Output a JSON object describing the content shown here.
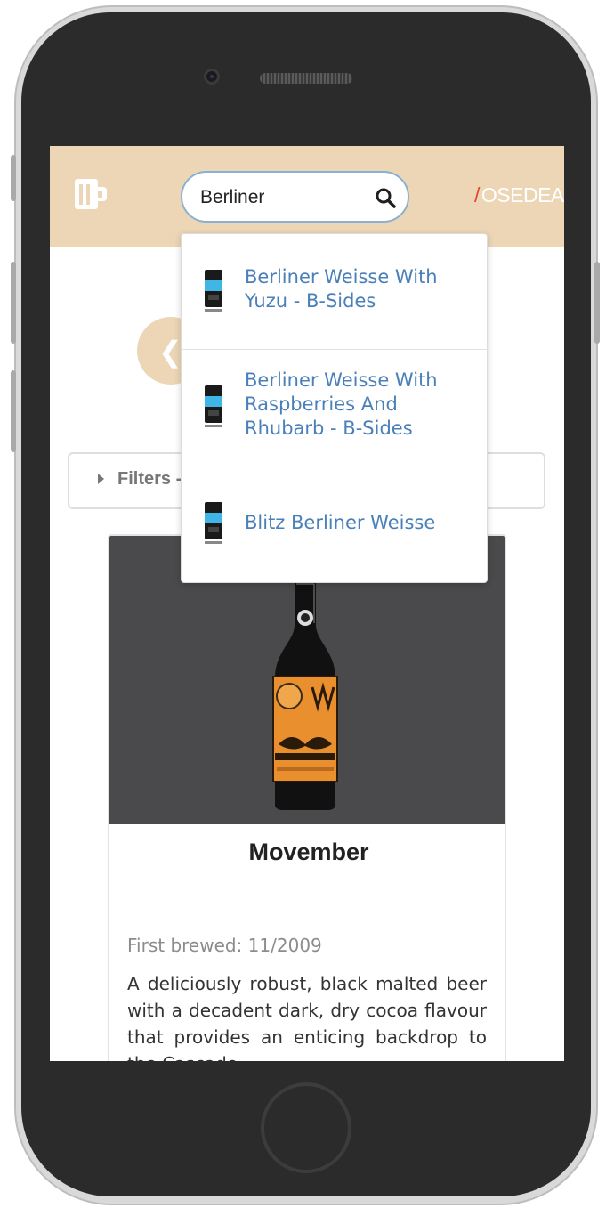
{
  "header": {
    "logo_icon": "beer-mug-icon",
    "brand_slash": "/",
    "brand_name": "OSEDEA",
    "colors": {
      "header_bg": "#ecd6b6",
      "link": "#4a80b9",
      "brand_slash": "#e6432e"
    }
  },
  "search": {
    "value": "Berliner",
    "icon": "search-icon"
  },
  "suggestions": [
    {
      "label": "Berliner Weisse With Yuzu - B-Sides",
      "thumb_icon": "beer-keg-icon"
    },
    {
      "label": "Berliner Weisse With Raspberries And Rhubarb - B-Sides",
      "thumb_icon": "beer-keg-icon"
    },
    {
      "label": "Blitz Berliner Weisse",
      "thumb_icon": "beer-keg-icon"
    }
  ],
  "nav": {
    "back_icon": "chevron-left-icon",
    "back_glyph": "❮"
  },
  "filters": {
    "label": "Filters -",
    "icon": "caret-right-icon"
  },
  "beer": {
    "name": "Movember",
    "first_brewed": "First brewed: 11/2009",
    "description": "A deliciously robust, black malted beer with a decadent dark, dry cocoa flavour that provides an enticing backdrop to the Cascade"
  }
}
